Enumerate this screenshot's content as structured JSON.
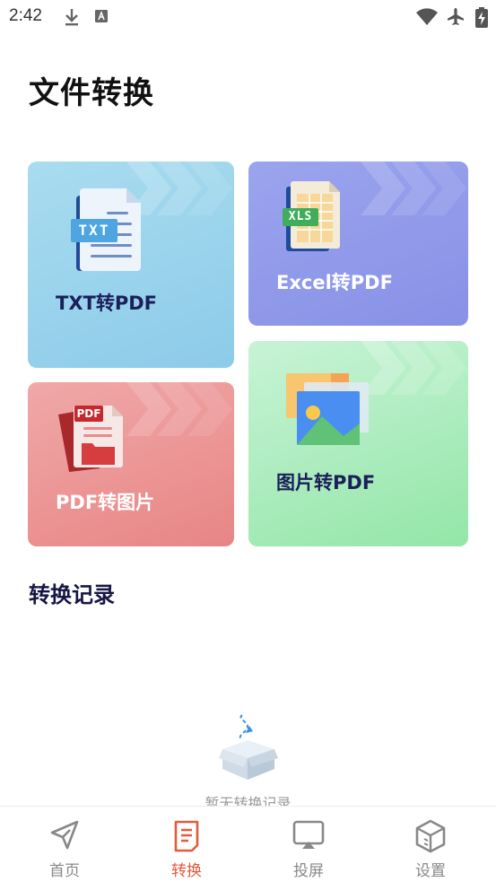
{
  "status_bar": {
    "time": "2:42",
    "left_icons": [
      "download-icon",
      "font-a-icon"
    ],
    "right_icons": [
      "wifi-icon",
      "airplane-icon",
      "battery-charging-icon"
    ]
  },
  "page": {
    "title": "文件转换"
  },
  "cards": {
    "txt": {
      "label": "TXT转PDF",
      "badge": "TXT"
    },
    "excel": {
      "label": "Excel转PDF",
      "badge": "XLS"
    },
    "pdf": {
      "label": "PDF转图片",
      "badge": "PDF"
    },
    "image": {
      "label": "图片转PDF"
    }
  },
  "records": {
    "title": "转换记录",
    "empty_text": "暂无转换记录"
  },
  "nav": {
    "items": [
      {
        "label": "首页",
        "icon": "send-icon",
        "active": false
      },
      {
        "label": "转换",
        "icon": "document-icon",
        "active": true
      },
      {
        "label": "投屏",
        "icon": "cast-screen-icon",
        "active": false
      },
      {
        "label": "设置",
        "icon": "cube-icon",
        "active": false
      }
    ]
  },
  "colors": {
    "accent": "#e35a3c",
    "txt_card": "#9ad4ed",
    "excel_card": "#8f99ea",
    "pdf_card": "#ec9696",
    "image_card": "#aeeebf"
  }
}
